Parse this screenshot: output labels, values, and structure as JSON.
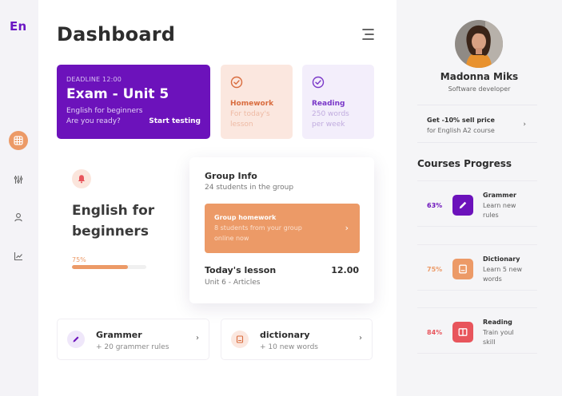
{
  "app": {
    "logo": "En"
  },
  "colors": {
    "purple": "#6c12bb",
    "orange": "#ec9a67",
    "red": "#e8555c"
  },
  "nav": [
    {
      "icon": "grid-icon",
      "active": true
    },
    {
      "icon": "sliders-icon",
      "active": false
    },
    {
      "icon": "user-icon",
      "active": false
    },
    {
      "icon": "chart-icon",
      "active": false
    }
  ],
  "header": {
    "title": "Dashboard",
    "menu_icon": "hamburger-menu-icon"
  },
  "exam_card": {
    "deadline": "DEADLINE 12:00",
    "title": "Exam - Unit 5",
    "line1": "English for beginners",
    "line2": "Are you ready?",
    "action": "Start testing"
  },
  "homework_card": {
    "title": "Homework",
    "line1": "For today's",
    "line2": "lesson",
    "icon": "check-circle-icon"
  },
  "reading_card": {
    "title": "Reading",
    "line1": "250 words",
    "line2": "per week",
    "icon": "check-circle-icon"
  },
  "course": {
    "title_line1": "English for",
    "title_line2": "beginners",
    "progress_label": "75%",
    "progress": 0.75,
    "icon": "bell-icon"
  },
  "group_info": {
    "title": "Group Info",
    "subtitle": "24 students in the group",
    "homework": {
      "title": "Group homework",
      "line1": "8 students from your group",
      "line2": "online now",
      "arrow": "›"
    },
    "lesson": {
      "title": "Today's lesson",
      "time": "12.00",
      "subtitle": "Unit 6 - Articles"
    }
  },
  "bottom_cards": [
    {
      "title": "Grammer",
      "subtitle": "+ 20 grammer rules",
      "icon": "pencil-icon",
      "arrow": "›"
    },
    {
      "title": "dictionary",
      "subtitle": "+ 10 new words",
      "icon": "book-icon",
      "arrow": "›"
    }
  ],
  "profile": {
    "name": "Madonna Miks",
    "role": "Software developer"
  },
  "promo": {
    "line1": "Get -10% sell price",
    "line2": "for English A2 course",
    "arrow": "›"
  },
  "courses_progress": {
    "title": "Courses Progress",
    "items": [
      {
        "pct": "63%",
        "name": "Grammer",
        "line1": "Learn new",
        "line2": "rules",
        "icon": "pencil-icon",
        "color": "#6c12bb"
      },
      {
        "pct": "75%",
        "name": "Dictionary",
        "line1": "Learn 5 new",
        "line2": "words",
        "icon": "book-icon",
        "color": "#ec9a67"
      },
      {
        "pct": "84%",
        "name": "Reading",
        "line1": "Train youl",
        "line2": "skill",
        "icon": "open-book-icon",
        "color": "#e8555c"
      }
    ]
  }
}
